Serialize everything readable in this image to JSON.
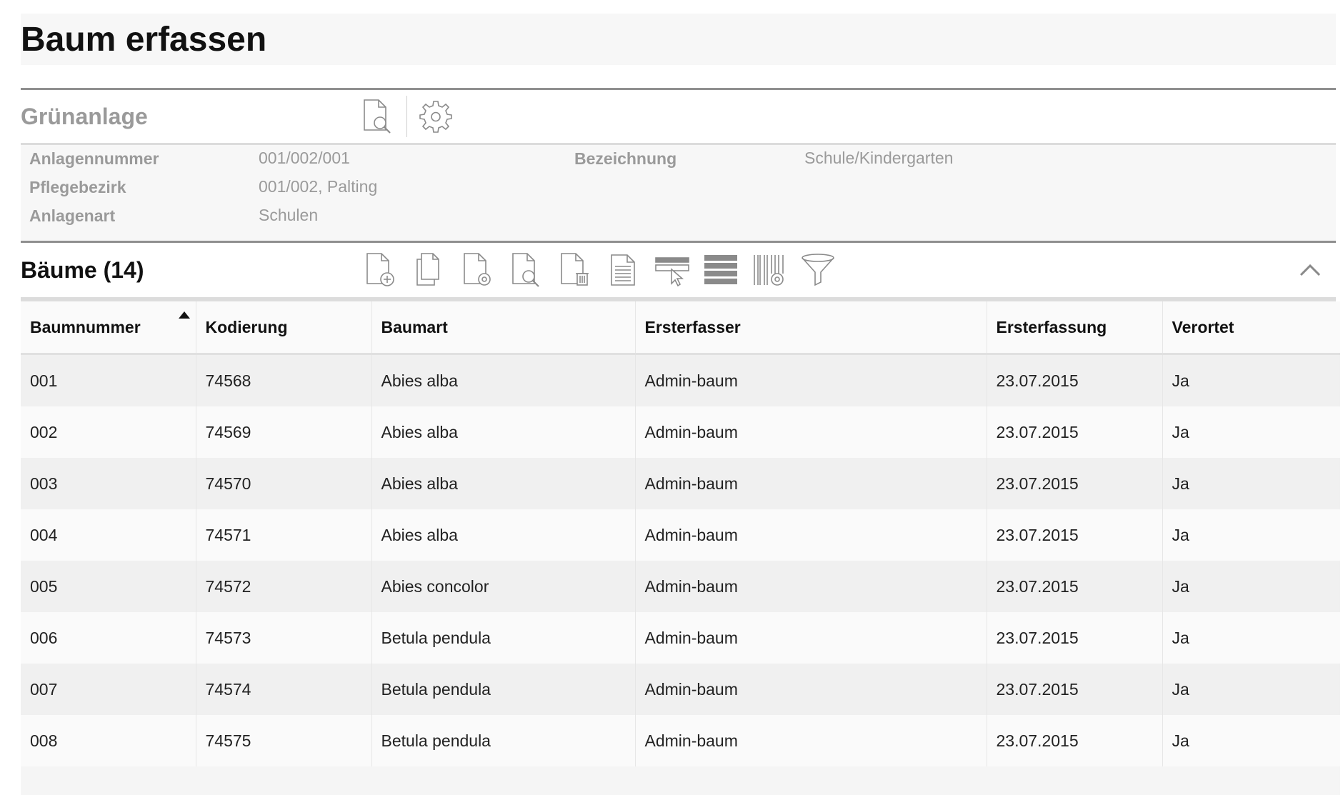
{
  "page": {
    "title": "Baum erfassen"
  },
  "gruenanlage": {
    "title": "Grünanlage",
    "actions": [
      {
        "name": "document-search-icon"
      },
      {
        "name": "gear-icon"
      }
    ],
    "fields": {
      "anlagennummer": {
        "label": "Anlagennummer",
        "value": "001/002/001"
      },
      "pflegebezirk": {
        "label": "Pflegebezirk",
        "value": "001/002, Palting"
      },
      "anlagenart": {
        "label": "Anlagenart",
        "value": "Schulen"
      },
      "bezeichnung": {
        "label": "Bezeichnung",
        "value": "Schule/Kindergarten"
      }
    }
  },
  "baeume": {
    "title": "Bäume (14)",
    "toolbar": [
      "add-document-icon",
      "copy-document-icon",
      "document-settings-icon",
      "document-search-icon",
      "delete-document-icon",
      "text-document-icon",
      "select-rows-icon",
      "list-view-icon",
      "barcode-settings-icon",
      "filter-icon"
    ],
    "collapse_icon": "chevron-up-icon",
    "columns": [
      "Baumnummer",
      "Kodierung",
      "Baumart",
      "Ersterfasser",
      "Ersterfassung",
      "Verortet"
    ],
    "sort": {
      "column": "Baumnummer",
      "direction": "ascending"
    },
    "rows": [
      [
        "001",
        "74568",
        "Abies alba",
        "Admin-baum",
        "23.07.2015",
        "Ja"
      ],
      [
        "002",
        "74569",
        "Abies alba",
        "Admin-baum",
        "23.07.2015",
        "Ja"
      ],
      [
        "003",
        "74570",
        "Abies alba",
        "Admin-baum",
        "23.07.2015",
        "Ja"
      ],
      [
        "004",
        "74571",
        "Abies alba",
        "Admin-baum",
        "23.07.2015",
        "Ja"
      ],
      [
        "005",
        "74572",
        "Abies concolor",
        "Admin-baum",
        "23.07.2015",
        "Ja"
      ],
      [
        "006",
        "74573",
        "Betula pendula",
        "Admin-baum",
        "23.07.2015",
        "Ja"
      ],
      [
        "007",
        "74574",
        "Betula pendula",
        "Admin-baum",
        "23.07.2015",
        "Ja"
      ],
      [
        "008",
        "74575",
        "Betula pendula",
        "Admin-baum",
        "23.07.2015",
        "Ja"
      ]
    ]
  }
}
